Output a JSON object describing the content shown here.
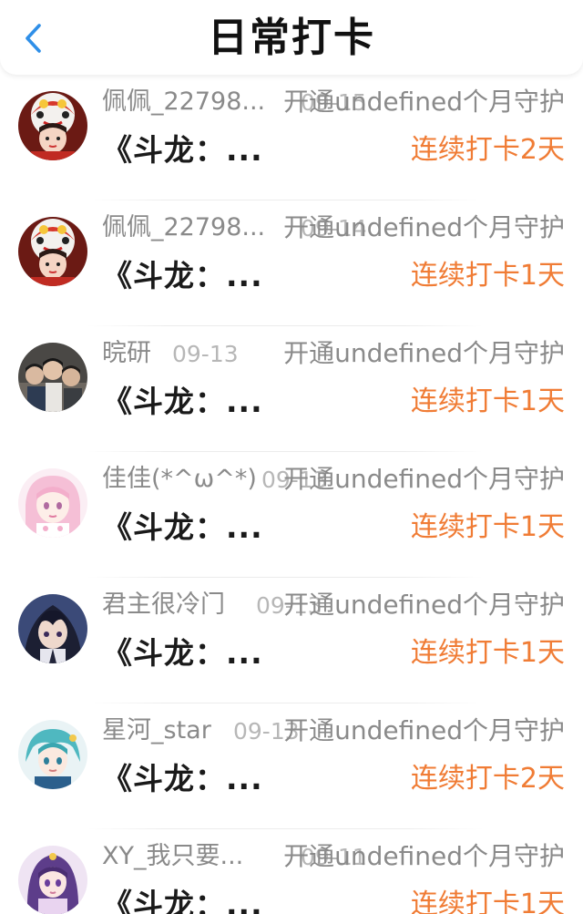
{
  "header": {
    "title": "日常打卡",
    "back_icon": "chevron-left-icon",
    "accent": "#2f8fe8"
  },
  "colors": {
    "streak": "#f07c35",
    "muted": "#8a8a8a",
    "date": "#b7b7b7"
  },
  "entries": [
    {
      "username": "佩佩_22798...",
      "date": "09-15",
      "action": "开通undefined个月守护",
      "book": "《斗龙：...",
      "streak": "连续打卡2天",
      "avatar": "lion-dance-girl"
    },
    {
      "username": "佩佩_22798...",
      "date": "09-14",
      "action": "开通undefined个月守护",
      "book": "《斗龙：...",
      "streak": "连续打卡1天",
      "avatar": "lion-dance-girl"
    },
    {
      "username": "晥研",
      "date": "09-13",
      "action": "开通undefined个月守护",
      "book": "《斗龙：...",
      "streak": "连续打卡1天",
      "avatar": "group-photo"
    },
    {
      "username": "佳佳(*^ω^*)",
      "date": "09-13",
      "action": "开通undefined个月守护",
      "book": "《斗龙：...",
      "streak": "连续打卡1天",
      "avatar": "pink-anime-girl"
    },
    {
      "username": "君主很冷门",
      "date": "09-13",
      "action": "开通undefined个月守护",
      "book": "《斗龙：...",
      "streak": "连续打卡1天",
      "avatar": "dark-anime-boy"
    },
    {
      "username": "星河_star",
      "date": "09-13",
      "action": "开通undefined个月守护",
      "book": "《斗龙：...",
      "streak": "连续打卡2天",
      "avatar": "teal-anime-boy"
    },
    {
      "username": "XY_我只要...",
      "date": "09-11",
      "action": "开通undefined个月守护",
      "book": "《斗龙：...",
      "streak": "连续打卡1天",
      "avatar": "purple-anime-girl"
    }
  ]
}
